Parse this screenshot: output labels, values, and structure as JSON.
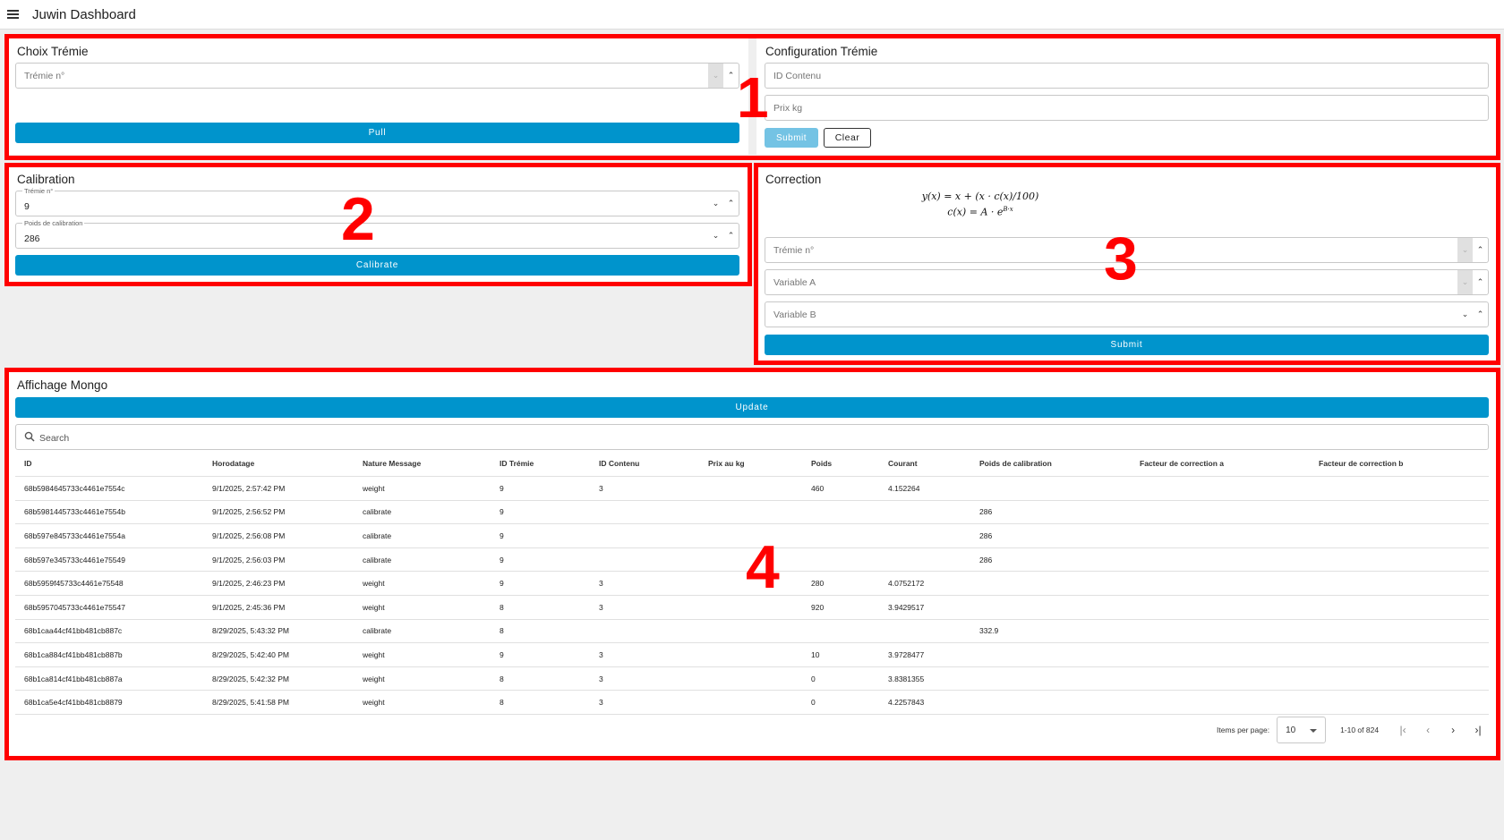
{
  "app": {
    "title": "Juwin Dashboard"
  },
  "choix": {
    "title": "Choix Trémie",
    "tremie_placeholder": "Trémie n°",
    "pull_label": "Pull"
  },
  "config": {
    "title": "Configuration Trémie",
    "id_placeholder": "ID Contenu",
    "prix_placeholder": "Prix kg",
    "submit_label": "Submit",
    "clear_label": "Clear"
  },
  "calibration": {
    "title": "Calibration",
    "tremie_label": "Trémie n°",
    "tremie_value": "9",
    "poids_label": "Poids de calibration",
    "poids_value": "286",
    "calibrate_label": "Calibrate"
  },
  "correction": {
    "title": "Correction",
    "formula_1": "y(x) = x + (x · c(x)/100)",
    "formula_2": "c(x) = A · e",
    "formula_2_exp": "B·x",
    "tremie_placeholder": "Trémie n°",
    "var_a_placeholder": "Variable A",
    "var_b_placeholder": "Variable B",
    "submit_label": "Submit"
  },
  "mongo": {
    "title": "Affichage Mongo",
    "update_label": "Update",
    "search_placeholder": "Search",
    "columns": [
      "ID",
      "Horodatage",
      "Nature Message",
      "ID Trémie",
      "ID Contenu",
      "Prix au kg",
      "Poids",
      "Courant",
      "Poids de calibration",
      "Facteur de correction a",
      "Facteur de correction b"
    ],
    "rows": [
      [
        "68b5984645733c4461e7554c",
        "9/1/2025, 2:57:42 PM",
        "weight",
        "9",
        "3",
        "",
        "460",
        "4.152264",
        "",
        "",
        ""
      ],
      [
        "68b5981445733c4461e7554b",
        "9/1/2025, 2:56:52 PM",
        "calibrate",
        "9",
        "",
        "",
        "",
        "",
        "286",
        "",
        ""
      ],
      [
        "68b597e845733c4461e7554a",
        "9/1/2025, 2:56:08 PM",
        "calibrate",
        "9",
        "",
        "",
        "",
        "",
        "286",
        "",
        ""
      ],
      [
        "68b597e345733c4461e75549",
        "9/1/2025, 2:56:03 PM",
        "calibrate",
        "9",
        "",
        "",
        "",
        "",
        "286",
        "",
        ""
      ],
      [
        "68b5959f45733c4461e75548",
        "9/1/2025, 2:46:23 PM",
        "weight",
        "9",
        "3",
        "",
        "280",
        "4.0752172",
        "",
        "",
        ""
      ],
      [
        "68b5957045733c4461e75547",
        "9/1/2025, 2:45:36 PM",
        "weight",
        "8",
        "3",
        "",
        "920",
        "3.9429517",
        "",
        "",
        ""
      ],
      [
        "68b1caa44cf41bb481cb887c",
        "8/29/2025, 5:43:32 PM",
        "calibrate",
        "8",
        "",
        "",
        "",
        "",
        "332.9",
        "",
        ""
      ],
      [
        "68b1ca884cf41bb481cb887b",
        "8/29/2025, 5:42:40 PM",
        "weight",
        "9",
        "3",
        "",
        "10",
        "3.9728477",
        "",
        "",
        ""
      ],
      [
        "68b1ca814cf41bb481cb887a",
        "8/29/2025, 5:42:32 PM",
        "weight",
        "8",
        "3",
        "",
        "0",
        "3.8381355",
        "",
        "",
        ""
      ],
      [
        "68b1ca5e4cf41bb481cb8879",
        "8/29/2025, 5:41:58 PM",
        "weight",
        "8",
        "3",
        "",
        "0",
        "4.2257843",
        "",
        "",
        ""
      ]
    ],
    "items_per_page_label": "Items per page:",
    "items_per_page_value": "10",
    "range_label": "1-10 of 824"
  },
  "annotations": {
    "n1": "1",
    "n2": "2",
    "n3": "3",
    "n4": "4"
  },
  "colors": {
    "primary": "#0094cc",
    "primary_disabled": "#74c3e4",
    "annotation": "#ff0000"
  }
}
